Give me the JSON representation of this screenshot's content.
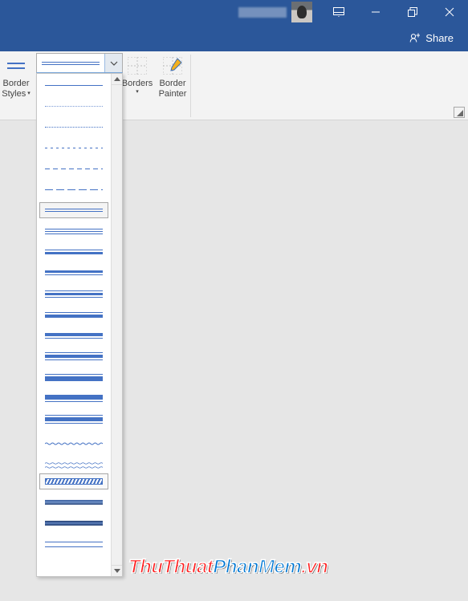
{
  "titlebar": {
    "user_name": "(redacted)"
  },
  "share": {
    "label": "Share"
  },
  "ribbon": {
    "border_styles": {
      "line1": "Border",
      "line2": "Styles"
    },
    "borders": {
      "label": "Borders"
    },
    "border_painter": {
      "line1": "Border",
      "line2": "Painter"
    }
  },
  "gallery": {
    "selected_index": 6,
    "hover_index": 19,
    "styles": [
      {
        "id": "single-thin",
        "lines": [
          {
            "h": 1
          }
        ]
      },
      {
        "id": "dotted-fine",
        "lines": [
          {
            "h": 1,
            "style": "dotted",
            "op": 0.7
          }
        ]
      },
      {
        "id": "dotted",
        "lines": [
          {
            "h": 1,
            "style": "dotted"
          }
        ]
      },
      {
        "id": "dashed-fine",
        "lines": [
          {
            "h": 1,
            "style": "dashed",
            "dash": "3 4"
          }
        ]
      },
      {
        "id": "dashed",
        "lines": [
          {
            "h": 1,
            "style": "dashed",
            "dash": "6 4"
          }
        ]
      },
      {
        "id": "long-dash",
        "lines": [
          {
            "h": 1,
            "style": "dashed",
            "dash": "10 4"
          }
        ]
      },
      {
        "id": "double-thin",
        "lines": [
          {
            "h": 1
          },
          {
            "h": 1
          }
        ]
      },
      {
        "id": "triple-thin",
        "lines": [
          {
            "h": 1
          },
          {
            "h": 1
          },
          {
            "h": 1
          }
        ]
      },
      {
        "id": "thin-thick",
        "lines": [
          {
            "h": 1
          },
          {
            "h": 3
          }
        ]
      },
      {
        "id": "thick-thin",
        "lines": [
          {
            "h": 3
          },
          {
            "h": 1
          }
        ]
      },
      {
        "id": "thin-thick-thin-sm",
        "lines": [
          {
            "h": 1
          },
          {
            "h": 3
          },
          {
            "h": 1
          }
        ]
      },
      {
        "id": "thin-thick-md",
        "lines": [
          {
            "h": 1
          },
          {
            "h": 4
          }
        ]
      },
      {
        "id": "thick-thin-md",
        "lines": [
          {
            "h": 4
          },
          {
            "h": 1
          }
        ]
      },
      {
        "id": "thin-thick-thin-md",
        "lines": [
          {
            "h": 1
          },
          {
            "h": 4
          },
          {
            "h": 1
          }
        ]
      },
      {
        "id": "thin-thick-lg",
        "lines": [
          {
            "h": 1
          },
          {
            "h": 6
          }
        ]
      },
      {
        "id": "thick-thin-lg",
        "lines": [
          {
            "h": 6
          },
          {
            "h": 1
          }
        ]
      },
      {
        "id": "thin-thick-thin-lg",
        "lines": [
          {
            "h": 1
          },
          {
            "h": 5
          },
          {
            "h": 1
          }
        ]
      },
      {
        "id": "wave-single",
        "lines": [
          {
            "h": 4,
            "wave": true
          }
        ]
      },
      {
        "id": "wave-double",
        "lines": [
          {
            "h": 3,
            "wave": true
          },
          {
            "h": 3,
            "wave": true
          }
        ]
      },
      {
        "id": "diag-stripe",
        "lines": [
          {
            "h": 8,
            "diag": true
          }
        ]
      },
      {
        "id": "emboss",
        "lines": [
          {
            "h": 6,
            "grad": "emboss"
          }
        ]
      },
      {
        "id": "engrave",
        "lines": [
          {
            "h": 6,
            "grad": "engrave"
          }
        ]
      },
      {
        "id": "outset",
        "lines": [
          {
            "h": 1
          },
          {
            "h": 1
          }
        ],
        "gap": 5
      }
    ]
  },
  "watermark": {
    "part1": "ThuThuat",
    "part2": "PhanMem",
    "part3": ".vn"
  },
  "colors": {
    "accent": "#2b579a",
    "line": "#4472c4"
  }
}
